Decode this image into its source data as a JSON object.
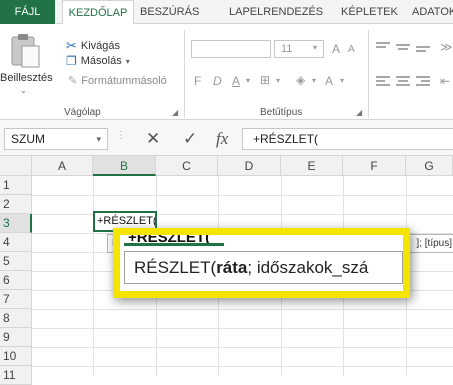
{
  "ribbon": {
    "tabs": [
      "FÁJL",
      "KEZDŐLAP",
      "BESZÚRÁS",
      "LAPELRENDEZÉS",
      "KÉPLETEK",
      "ADATOK"
    ],
    "clipboard": {
      "paste_label": "Beillesztés",
      "cut_label": "Kivágás",
      "copy_label": "Másolás",
      "format_painter_label": "Formátummásoló",
      "group_label": "Vágólap"
    },
    "font": {
      "size": "11",
      "grow": "A",
      "shrink": "A",
      "bold": "F",
      "italic": "D",
      "underline": "A",
      "font_color": "A",
      "group_label": "Betűtípus"
    },
    "launcher_icon": "dialog-launcher-icon"
  },
  "formula_bar": {
    "name_box": "SZUM",
    "cancel": "✕",
    "confirm": "✓",
    "fx": "fx",
    "content": "+RÉSZLET("
  },
  "grid": {
    "columns": [
      "A",
      "B",
      "C",
      "D",
      "E",
      "F",
      "G"
    ],
    "rows": [
      "1",
      "2",
      "3",
      "4",
      "5",
      "6",
      "7",
      "8",
      "9",
      "10",
      "11"
    ],
    "active_cell_text": "+RÉSZLET(",
    "tooltip_right": "]; [típus]",
    "tooltip_left": "R"
  },
  "callout": {
    "cell_text": "+RÉSZLET(",
    "fn_name": "RÉSZLET(",
    "arg_active": "ráta",
    "arg_rest": "; időszakok_szá",
    "border_color": "#f5e400"
  },
  "colors": {
    "accent": "#217346",
    "highlight": "#f5e400"
  }
}
